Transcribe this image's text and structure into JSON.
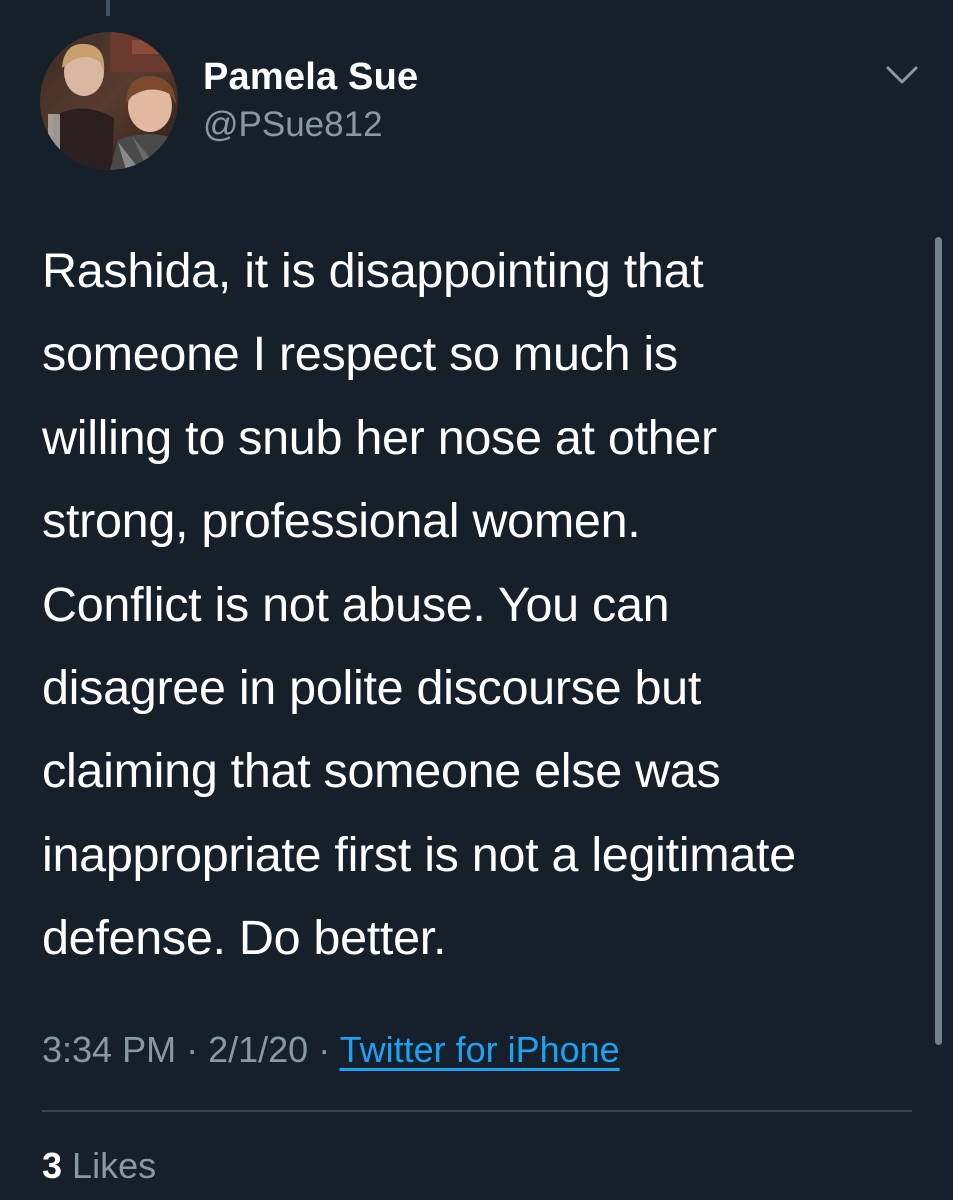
{
  "tweet": {
    "author": {
      "name": "Pamela Sue",
      "handle": "@PSue812"
    },
    "text_lines": [
      "Rashida, it is disappointing that",
      "someone I respect so much is",
      "willing to snub her nose at other",
      "strong, professional women.",
      "Conflict is not abuse. You can",
      "disagree in polite discourse but",
      "claiming that someone else was",
      "inappropriate first is not a legitimate",
      "defense. Do better."
    ],
    "time": "3:34 PM",
    "separator": "·",
    "date": "2/1/20",
    "source": "Twitter for iPhone",
    "likes_count": "3",
    "likes_label": "Likes"
  },
  "icons": {
    "menu": "chevron-down-icon",
    "avatar": "profile-photo"
  },
  "colors": {
    "background": "#15202b",
    "primary_text": "#ffffff",
    "secondary_text": "#8899a6",
    "link": "#1da1f2",
    "divider": "#38444d"
  }
}
